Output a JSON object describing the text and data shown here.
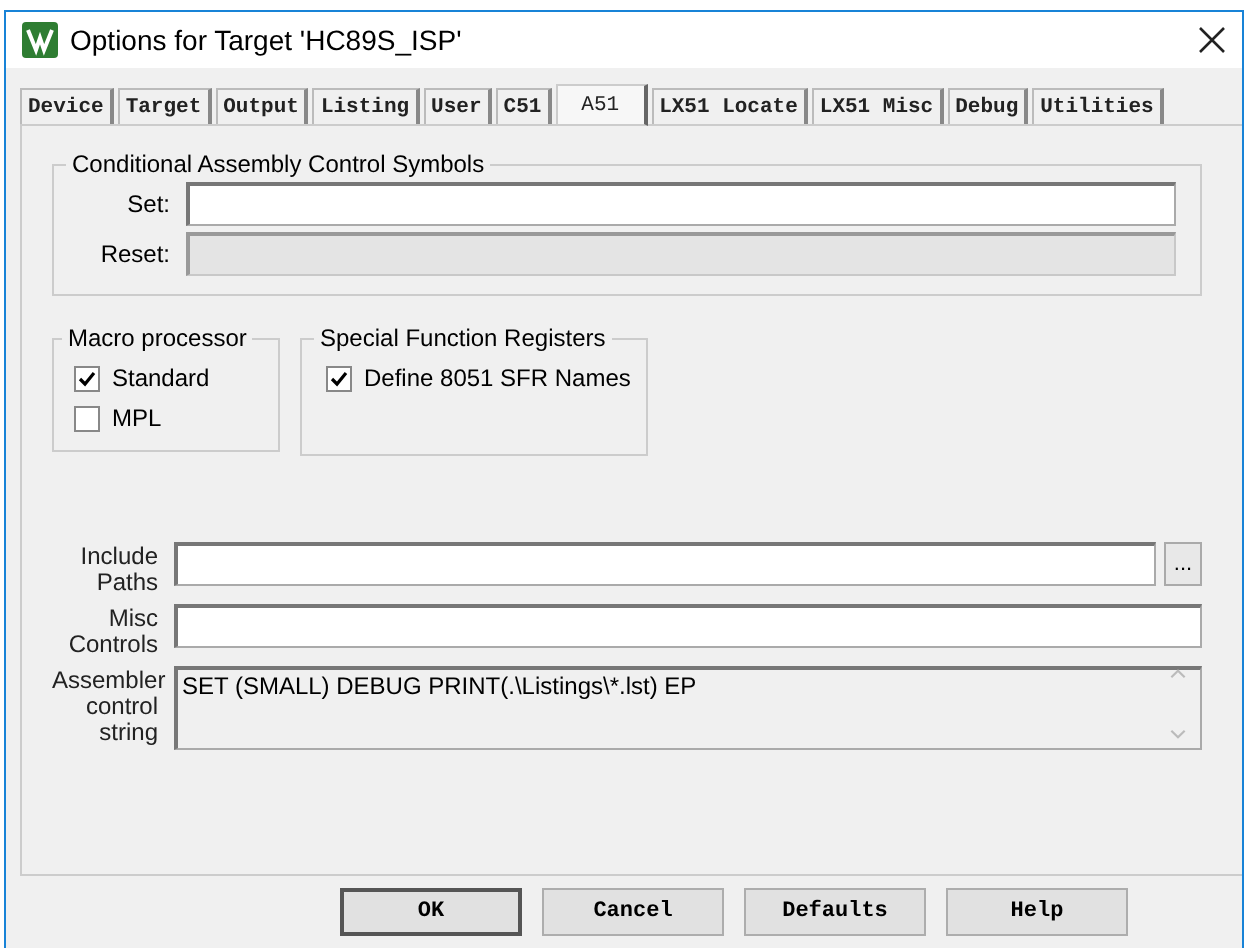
{
  "window": {
    "title": "Options for Target 'HC89S_ISP'"
  },
  "tabs": [
    {
      "label": "Device",
      "selected": false
    },
    {
      "label": "Target",
      "selected": false
    },
    {
      "label": "Output",
      "selected": false
    },
    {
      "label": "Listing",
      "selected": false
    },
    {
      "label": "User",
      "selected": false
    },
    {
      "label": "C51",
      "selected": false
    },
    {
      "label": "A51",
      "selected": true
    },
    {
      "label": "LX51 Locate",
      "selected": false
    },
    {
      "label": "LX51 Misc",
      "selected": false
    },
    {
      "label": "Debug",
      "selected": false
    },
    {
      "label": "Utilities",
      "selected": false
    }
  ],
  "conditional_assembly": {
    "title": "Conditional Assembly Control Symbols",
    "fields": [
      {
        "label": "Set:",
        "disabled": false
      },
      {
        "label": "Reset:",
        "disabled": true
      }
    ]
  },
  "macro_processor": {
    "title": "Macro processor",
    "options": [
      {
        "label": "Standard",
        "checked": true
      },
      {
        "label": "MPL",
        "checked": false
      }
    ]
  },
  "sfr": {
    "title": "Special Function Registers",
    "options": [
      {
        "label": "Define 8051 SFR Names",
        "checked": true
      }
    ]
  },
  "include_paths": {
    "label": "Include Paths",
    "browse": "..."
  },
  "misc_controls": {
    "label": "Misc Controls"
  },
  "control_string": {
    "label": "Assembler control string",
    "value": "SET (SMALL) DEBUG PRINT(.\\Listings\\*.lst) EP"
  },
  "buttons": [
    "OK",
    "Cancel",
    "Defaults",
    "Help"
  ]
}
